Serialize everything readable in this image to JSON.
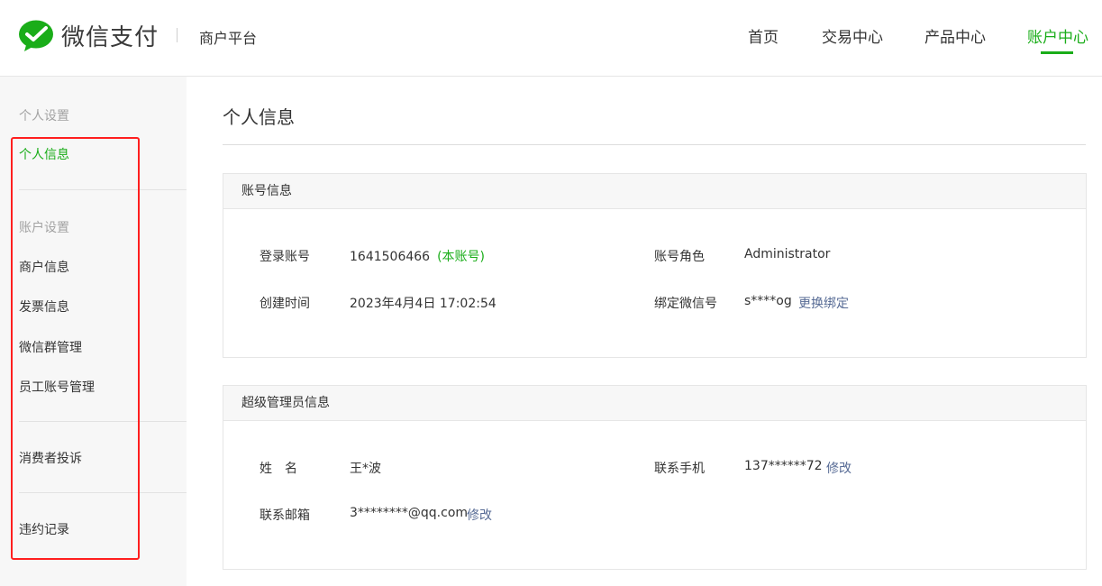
{
  "header": {
    "brand": "微信支付",
    "platform": "商户平台",
    "nav": [
      "首页",
      "交易中心",
      "产品中心",
      "账户中心"
    ],
    "active_nav": "账户中心"
  },
  "sidebar": {
    "group1_title": "个人设置",
    "item_personal": "个人信息",
    "group2_title": "账户设置",
    "item_merchant": "商户信息",
    "item_invoice": "发票信息",
    "item_wechat_group": "微信群管理",
    "item_staff": "员工账号管理",
    "item_complaint": "消费者投诉",
    "item_violation": "违约记录"
  },
  "main": {
    "title": "个人信息",
    "account_card": {
      "title": "账号信息",
      "login_label": "登录账号",
      "login_value": "1641506466",
      "login_tag": "(本账号)",
      "role_label": "账号角色",
      "role_value": "Administrator",
      "created_label": "创建时间",
      "created_value": "2023年4月4日 17:02:54",
      "wechat_label": "绑定微信号",
      "wechat_value": "s****og",
      "wechat_action": "更换绑定"
    },
    "admin_card": {
      "title": "超级管理员信息",
      "name_label": "姓　名",
      "name_value": "王*波",
      "phone_label": "联系手机",
      "phone_value": "137******72",
      "phone_action": "修改",
      "email_label": "联系邮箱",
      "email_value": "3********@qq.com",
      "email_action": "修改"
    }
  },
  "colors": {
    "brand_green": "#1aad19",
    "link_blue": "#576b95",
    "highlight_red": "#ff1f1f"
  }
}
